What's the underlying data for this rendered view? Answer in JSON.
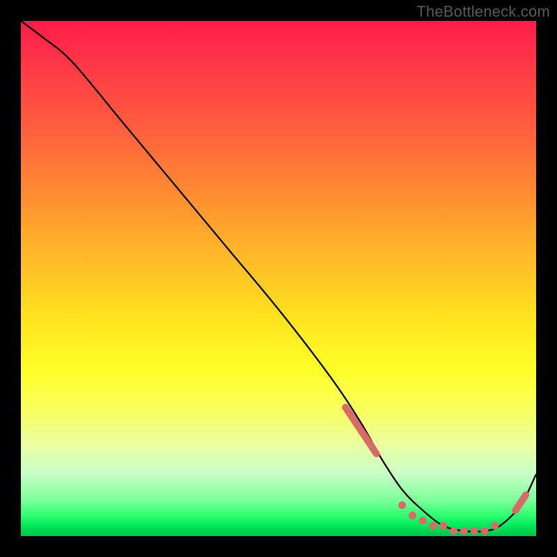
{
  "watermark": "TheBottleneck.com",
  "chart_data": {
    "type": "line",
    "title": "",
    "xlabel": "",
    "ylabel": "",
    "x_range": [
      0,
      100
    ],
    "y_range": [
      0,
      100
    ],
    "series": [
      {
        "name": "bottleneck-curve",
        "x": [
          0,
          4,
          10,
          20,
          30,
          40,
          50,
          60,
          66,
          70,
          74,
          78,
          82,
          86,
          90,
          93,
          97,
          100
        ],
        "y": [
          100,
          97,
          92,
          80,
          68,
          56,
          44,
          31,
          22,
          15,
          9,
          5,
          2,
          1,
          1,
          2,
          6,
          12
        ]
      }
    ],
    "marker_clusters": [
      {
        "name": "slope-cluster",
        "x_start": 63,
        "x_end": 69,
        "y_start": 25,
        "y_end": 16
      },
      {
        "name": "bottom-cluster",
        "points": [
          {
            "x": 74,
            "y": 6
          },
          {
            "x": 76,
            "y": 4
          },
          {
            "x": 78,
            "y": 3
          },
          {
            "x": 80,
            "y": 2
          },
          {
            "x": 82,
            "y": 2
          },
          {
            "x": 84,
            "y": 1
          },
          {
            "x": 86,
            "y": 1
          },
          {
            "x": 88,
            "y": 1
          },
          {
            "x": 90,
            "y": 1
          },
          {
            "x": 92,
            "y": 2
          }
        ]
      },
      {
        "name": "rise-cluster",
        "x_start": 96,
        "x_end": 98,
        "y_start": 5,
        "y_end": 8
      }
    ],
    "background": "rainbow-vertical",
    "grid": false,
    "legend": false
  }
}
